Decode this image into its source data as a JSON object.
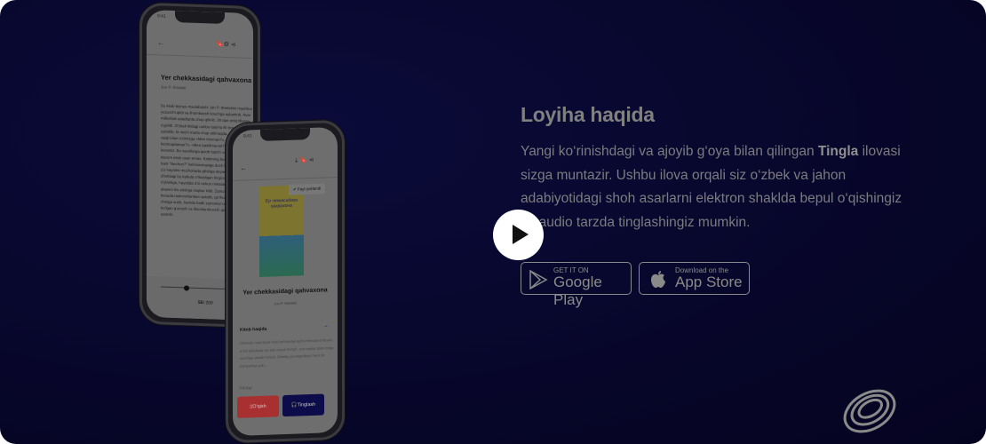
{
  "section": {
    "heading": "Loyiha haqida",
    "desc_before": "Yangi ko‘rinishdagi va ajoyib g‘oya bilan qilingan ",
    "desc_bold": "Tingla",
    "desc_after": " ilovasi sizga muntazir. Ushbu ilova orqali siz o‘zbek va jahon adabiyotidagi shoh asarlarni elektron shaklda bepul o‘qishingiz va audio tarzda tinglashingiz mumkin."
  },
  "stores": {
    "google_small": "GET IT ON",
    "google_large": "Google Play",
    "apple_small": "Download on the",
    "apple_large": "App Store"
  },
  "phone1": {
    "time": "9:41",
    "title": "Yer chekkasidagi qahvaxona",
    "author": "Jon P. Streleki",
    "body": "Bu kitob biznes-maslahatchi Jon P. Strelekini mashhur yozuvchi qildi va ilhombaxsh kouchga aylantirdi. Asar millionlab adadlarda chop qilinib, 30 dan ortiq tillarga o'girildi. O'zbek tilidagi ushbu tarjima ilk bor amalga oshirilib, bi rinchi marta chop etilmoqda. Xar birimiz vaqti-vaqti bilan o'zimizga «Men kimman?», «qayoqqa ketmoqdaman?», «Men baxtlimanmi?» degan savollar beramiz. Bu savollarga javob topish va o'z yo'limizda davom etish oson emas. Kitobning bosh qahramoni Jon ham \"Nechun?\" kahvaxonasiga duch kelib qolmagunicha o'z hayotini mushohada qilishga deyarli urinmagan. Dunyo chetidagi bu kafeda o'tkazilgan birgina tun o'zi haqida o'ylashga, hayotida o'zi uchun nimalar muhim va muhim ekanini his etishga majbur kildi. Zamonaviy xayotning bexuda tashvishlaridan qutulib, qo'rkuvlar va shubhalarni chetga surib, hamda badli zamonlar uchun ochilishi lozim bo'lgan g'aroyib va ilhomlantiruvchi qissa aynan shu asardir.",
    "page_current": "55",
    "page_total": "/ 200",
    "progress": 0.28
  },
  "phone2": {
    "time": "9:41",
    "toast": "Fayl yuklandi",
    "cover_title": "Ер чеккасидаги қаҳвахона",
    "title": "Yer chekkasidagi qahvaxona",
    "author": "Jon P. Streleki",
    "about_label": "Kitob haqida",
    "about_text": "Odamda mas'uliyat hissi bo'lmasligi aybni birovga to'nkash, o'zini jabrdiyda his etib norozi bo'lish, oxir-oqibat ahmi ortga surishga sabab bo'ladi. Streeliy javobgarliksiz hech bir kompaniya yoki...",
    "comments_label": "Fikrlar",
    "read_label": "O'qish",
    "listen_label": "Tinglash"
  },
  "colors": {
    "read": "#a83030",
    "listen": "#0c0c4a",
    "bg": "#07062a"
  }
}
